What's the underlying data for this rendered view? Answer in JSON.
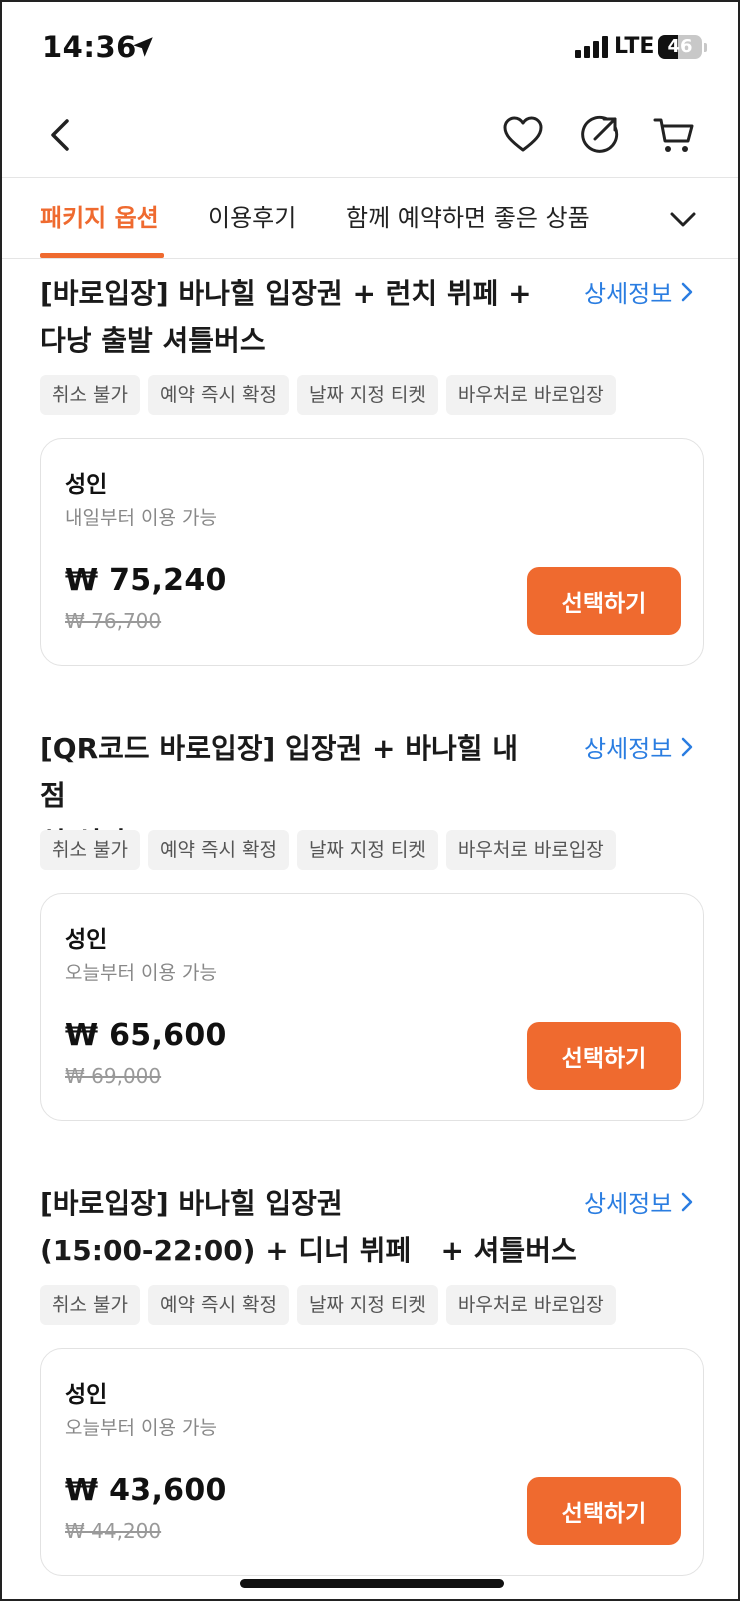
{
  "status_bar": {
    "time": "14:36",
    "network": "LTE",
    "battery_level": "46",
    "battery_fraction": 0.46
  },
  "nav": {
    "back_icon": "chevron-left-icon",
    "wishlist_icon": "heart-icon",
    "share_icon": "share-icon",
    "cart_icon": "cart-icon"
  },
  "tabs": {
    "items": [
      {
        "label": "패키지 옵션",
        "active": true
      },
      {
        "label": "이용후기",
        "active": false
      },
      {
        "label": "함께 예약하면 좋은 상품",
        "active": false
      }
    ],
    "accent_color": "#ef6a2f"
  },
  "packages": [
    {
      "title_line1": "[바로입장] 바나힐 입장권 + 런치 뷔페 +",
      "title_line2": "다낭 출발 셔틀버스",
      "detail_label": "상세정보",
      "tags": [
        "취소 불가",
        "예약 즉시 확정",
        "날짜 지정 티켓",
        "바우처로 바로입장"
      ],
      "option": {
        "name": "성인",
        "availability": "내일부터 이용 가능",
        "price": "₩ 75,240",
        "original_price": "₩ 76,700",
        "button_label": "선택하기"
      }
    },
    {
      "title_line1": "[QR코드 바로입장] 입장권 + 바나힐 내 점",
      "title_line2": "심 식사",
      "detail_label": "상세정보",
      "tags": [
        "취소 불가",
        "예약 즉시 확정",
        "날짜 지정 티켓",
        "바우처로 바로입장"
      ],
      "option": {
        "name": "성인",
        "availability": "오늘부터 이용 가능",
        "price": "₩ 65,600",
        "original_price": "₩ 69,000",
        "button_label": "선택하기"
      }
    },
    {
      "title_line1": "[바로입장] 바나힐 입장권",
      "title_line2": "(15:00-22:00) + 디너 뷔페   + 셔틀버스",
      "detail_label": "상세정보",
      "tags": [
        "취소 불가",
        "예약 즉시 확정",
        "날짜 지정 티켓",
        "바우처로 바로입장"
      ],
      "option": {
        "name": "성인",
        "availability": "오늘부터 이용 가능",
        "price": "₩ 43,600",
        "original_price": "₩ 44,200",
        "button_label": "선택하기"
      }
    }
  ]
}
